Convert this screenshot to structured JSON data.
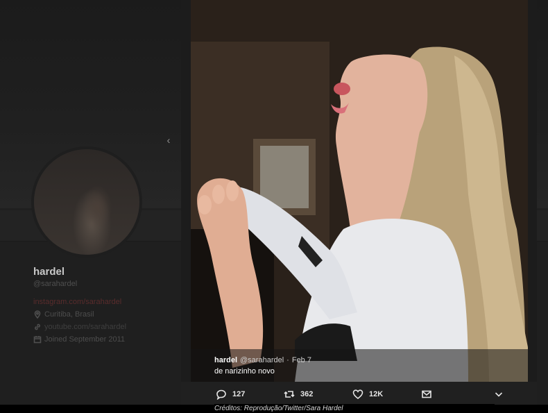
{
  "profile": {
    "name": "hardel",
    "handle": "@sarahardel",
    "bio": "instagram.com/sarahardel",
    "location": "Curitiba, Brasil",
    "website": "youtube.com/sarahardel",
    "joined": "Joined September 2011"
  },
  "tweet": {
    "name": "hardel",
    "handle": "@sarahardel",
    "separator": "·",
    "date": "Feb 7",
    "text": "de narizinho novo"
  },
  "actions": {
    "replies": "127",
    "retweets": "362",
    "likes": "12K"
  },
  "credit": "Créditos: Reprodução/Twitter/Sara Hardel",
  "icons": {
    "prev": "chevron-left-icon",
    "reply": "reply-icon",
    "retweet": "retweet-icon",
    "like": "heart-icon",
    "dm": "envelope-icon",
    "more": "chevron-down-icon"
  }
}
